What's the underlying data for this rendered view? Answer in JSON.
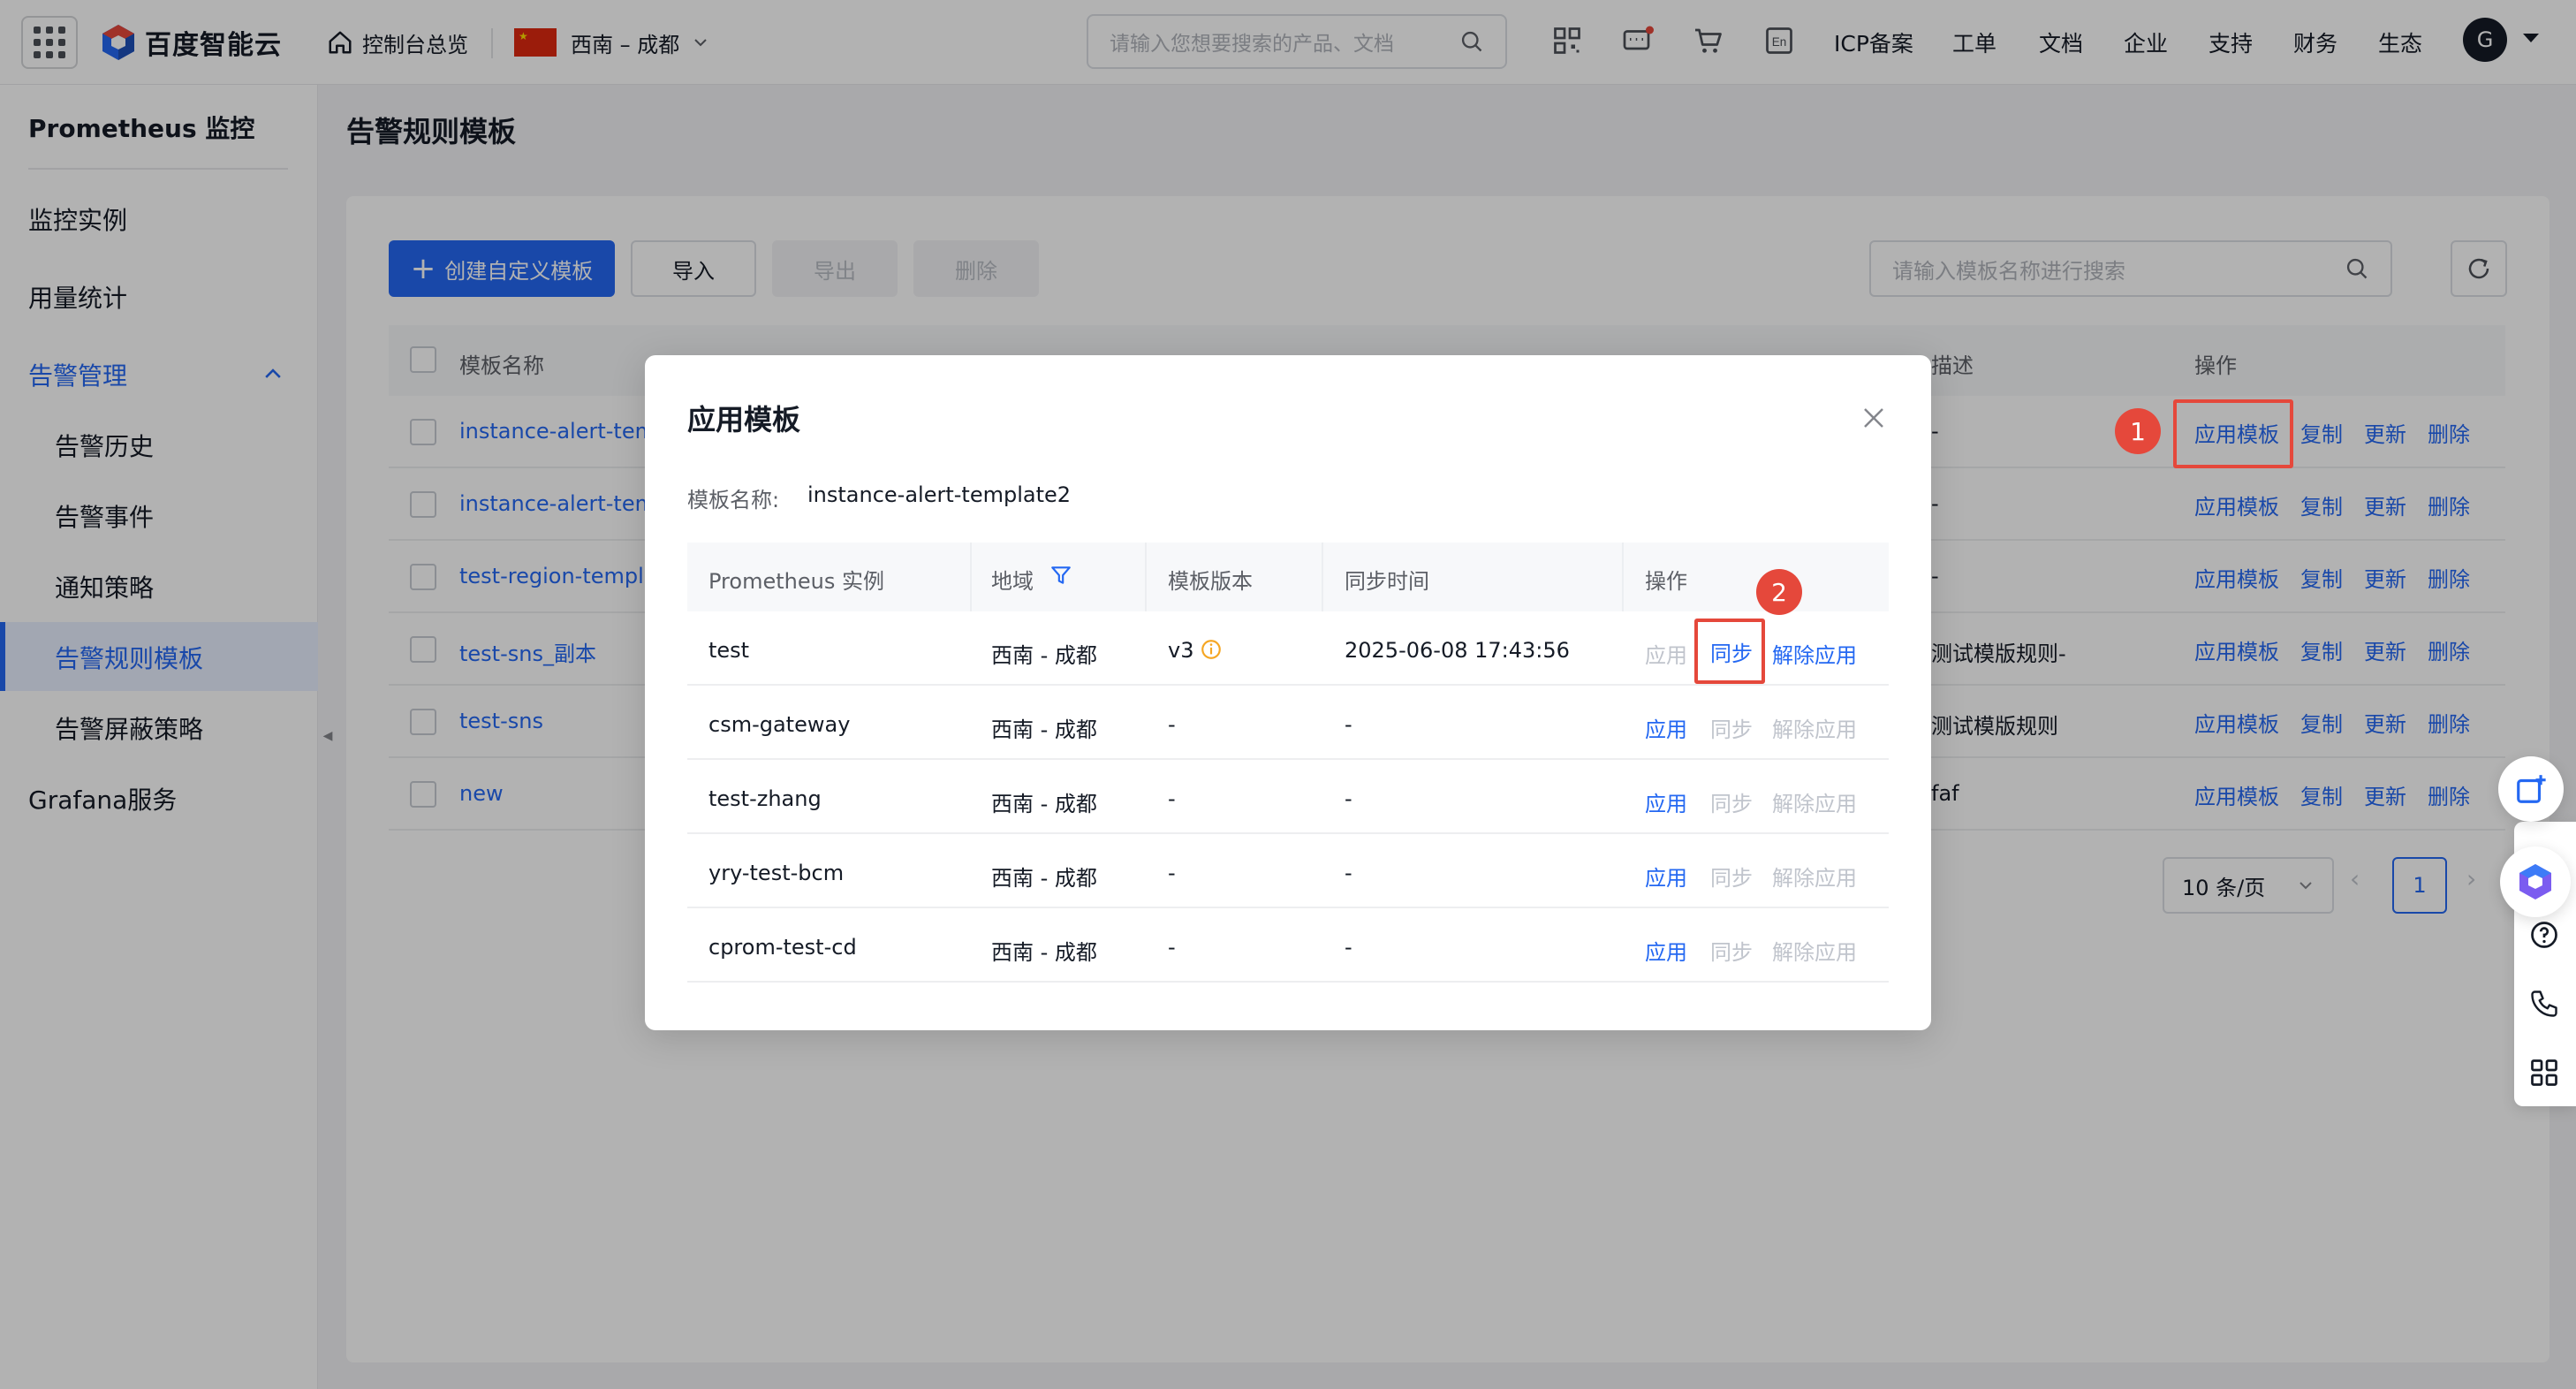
{
  "topbar": {
    "brand": "百度智能云",
    "console_link": "控制台总览",
    "region": "西南 – 成都",
    "search_placeholder": "请输入您想要搜索的产品、文档",
    "nav": [
      "ICP备案",
      "工单",
      "文档",
      "企业",
      "支持",
      "财务",
      "生态"
    ],
    "avatar_letter": "G"
  },
  "sidebar": {
    "title": "Prometheus 监控",
    "items": [
      {
        "label": "监控实例"
      },
      {
        "label": "用量统计"
      },
      {
        "label": "告警管理"
      },
      {
        "label": "告警历史"
      },
      {
        "label": "告警事件"
      },
      {
        "label": "通知策略"
      },
      {
        "label": "告警规则模板"
      },
      {
        "label": "告警屏蔽策略"
      },
      {
        "label": "Grafana服务"
      }
    ]
  },
  "page": {
    "title": "告警规则模板",
    "toolbar": {
      "create": "创建自定义模板",
      "import": "导入",
      "export": "导出",
      "delete": "删除",
      "search_placeholder": "请输入模板名称进行搜索"
    },
    "table": {
      "headers": [
        "模板名称",
        "描述",
        "操作"
      ],
      "rows": [
        {
          "name": "instance-alert-tem",
          "desc": "-"
        },
        {
          "name": "instance-alert-tem",
          "desc": "-"
        },
        {
          "name": "test-region-templa",
          "desc": "-"
        },
        {
          "name": "test-sns_副本",
          "desc": "测试模版规则-"
        },
        {
          "name": "test-sns",
          "desc": "测试模版规则"
        },
        {
          "name": "new",
          "desc": "faf"
        }
      ],
      "row_actions": [
        "应用模板",
        "复制",
        "更新",
        "删除"
      ]
    },
    "pagination": {
      "page_size": "10 条/页",
      "current_page": "1"
    }
  },
  "modal": {
    "title": "应用模板",
    "template_name_label": "模板名称:",
    "template_name_value": "instance-alert-template2",
    "headers": [
      "Prometheus 实例",
      "地域",
      "模板版本",
      "同步时间",
      "操作"
    ],
    "actions": [
      "应用",
      "同步",
      "解除应用"
    ],
    "rows": [
      {
        "instance": "test",
        "region": "西南 - 成都",
        "version": "v3",
        "sync_time": "2025-06-08 17:43:56",
        "enabled": [
          false,
          true,
          true
        ]
      },
      {
        "instance": "csm-gateway",
        "region": "西南 - 成都",
        "version": "-",
        "sync_time": "-",
        "enabled": [
          true,
          false,
          false
        ]
      },
      {
        "instance": "test-zhang",
        "region": "西南 - 成都",
        "version": "-",
        "sync_time": "-",
        "enabled": [
          true,
          false,
          false
        ]
      },
      {
        "instance": "yry-test-bcm",
        "region": "西南 - 成都",
        "version": "-",
        "sync_time": "-",
        "enabled": [
          true,
          false,
          false
        ]
      },
      {
        "instance": "cprom-test-cd",
        "region": "西南 - 成都",
        "version": "-",
        "sync_time": "-",
        "enabled": [
          true,
          false,
          false
        ]
      }
    ]
  },
  "annotations": {
    "badge_1": "1",
    "badge_2": "2"
  },
  "colors": {
    "primary": "#2468f2",
    "annotation": "#e5483b",
    "warning": "#f5a623"
  }
}
